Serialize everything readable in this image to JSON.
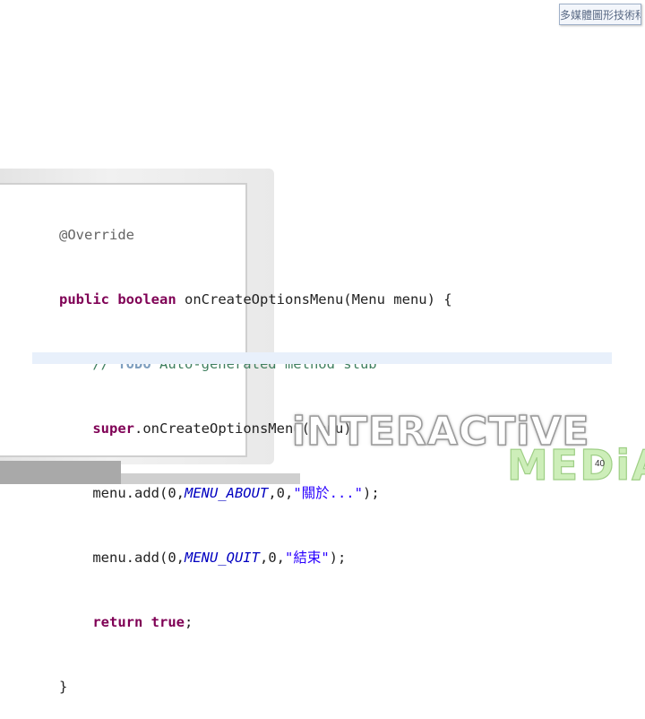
{
  "badge": {
    "text": "多媒體圖形技術科"
  },
  "code": {
    "line1": "@Override",
    "line2": {
      "kw_public": "public",
      "kw_boolean": "boolean",
      "rest": " onCreateOptionsMenu(Menu menu) {"
    },
    "line3": {
      "indent": "    ",
      "comment_start": "// ",
      "todo": "TODO",
      "comment_rest": " Auto-generated method stub"
    },
    "line4": {
      "indent": "    ",
      "kw_super": "super",
      "rest": ".onCreateOptionsMenu(menu);"
    },
    "line5": {
      "prefix": "    menu.add(0,",
      "field": "MENU_ABOUT",
      "mid": ",0,",
      "string": "\"關於...\"",
      "suffix": ");"
    },
    "line6": {
      "prefix": "    menu.add(0,",
      "field": "MENU_QUIT",
      "mid": ",0,",
      "string": "\"結束\"",
      "suffix": ");"
    },
    "line7": {
      "indent": "    ",
      "kw_return": "return",
      "kw_true": "true",
      "suffix": ";"
    },
    "line8": "}"
  },
  "logo": {
    "line1": "iNTERACTiVE",
    "line2": "MEDiA"
  },
  "page_number": "40"
}
